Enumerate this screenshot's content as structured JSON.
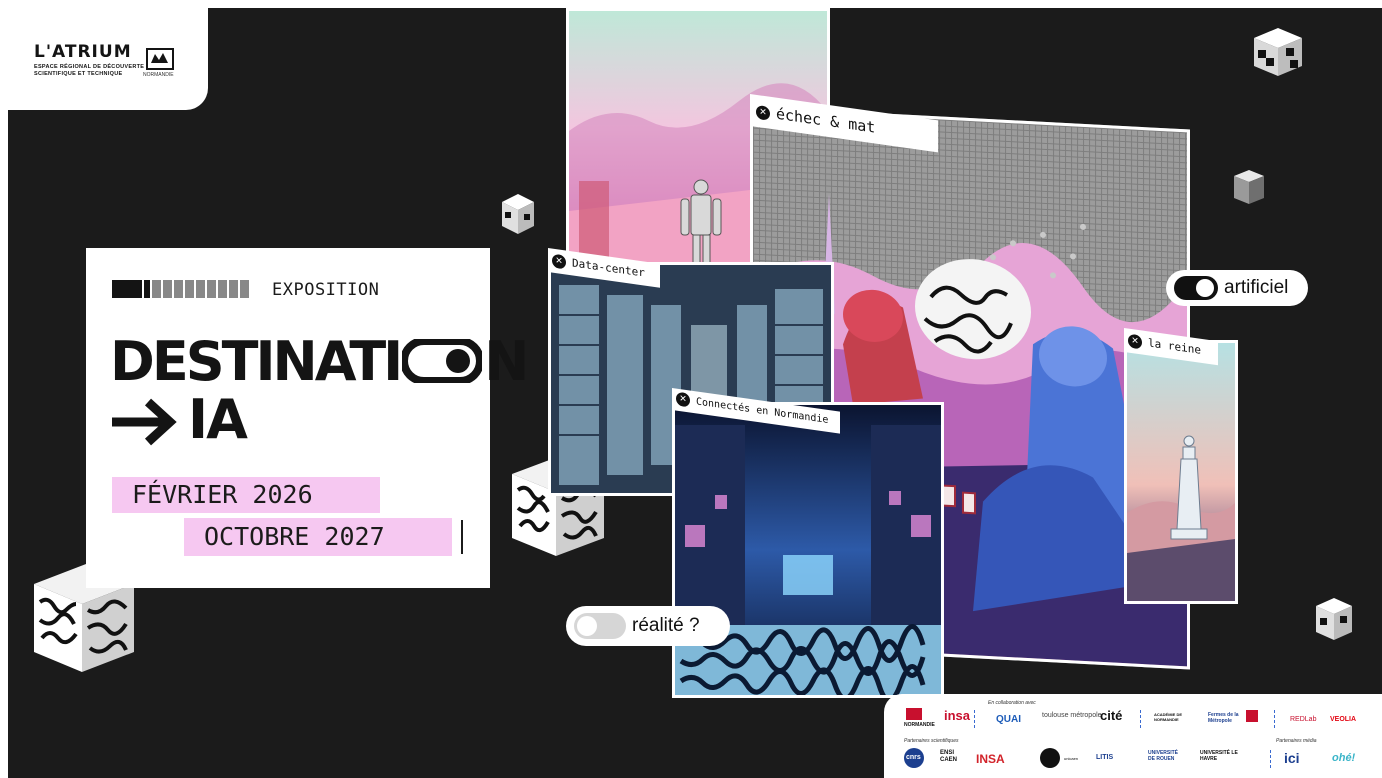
{
  "logo": {
    "name": "L'ATRIUM",
    "subtitle_line1": "ESPACE RÉGIONAL DE DÉCOUVERTE",
    "subtitle_line2": "SCIENTIFIQUE ET TECHNIQUE",
    "region": "NORMANDIE"
  },
  "card": {
    "kicker": "EXPOSITION",
    "title_line1": "DESTINATI",
    "title_line1_end": "N",
    "title_line2": "IA",
    "date_start": "FÉVRIER 2026",
    "date_end": "OCTOBRE 2027"
  },
  "panels": {
    "echec": "échec & mat",
    "datacenter": "Data-center",
    "connectes": "Connectés en Normandie",
    "reine": "la reine"
  },
  "toggles": {
    "artificiel": "artificiel",
    "realite": "réalité ?"
  },
  "partners": {
    "collab_caption": "En collaboration avec",
    "sci_caption": "Partenaires scientifiques",
    "media_caption": "Partenaires média",
    "logos_row1": [
      "NORMANDIE",
      "insa",
      "QUAI",
      "toulouse métropole",
      "cité",
      "ACADÉMIE DE NORMANDIE",
      "Fermes de la Métropole",
      "REDLab",
      "VEOLIA"
    ],
    "logos_row2": [
      "cnrs",
      "ENSI CAEN",
      "INSA",
      "unicaen",
      "LITIS",
      "UNIVERSITÉ DE ROUEN",
      "UNIVERSITÉ LE HAVRE",
      "ici",
      "ohé!"
    ]
  },
  "colors": {
    "background": "#1b1b1b",
    "accent_pink": "#f6c8f1",
    "card": "#ffffff"
  }
}
